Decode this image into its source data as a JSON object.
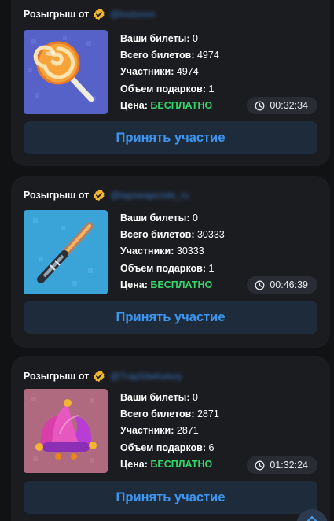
{
  "giveaways": [
    {
      "header_label": "Розыгрыш от",
      "handle": "@lootsmm",
      "prize": "lollipop",
      "labels": {
        "your_tickets": "Ваши билеты:",
        "total_tickets": "Всего билетов:",
        "participants": "Участники:",
        "gifts_count": "Объем подарков:",
        "price": "Цена:"
      },
      "your_tickets": "0",
      "total_tickets": "4974",
      "participants": "4974",
      "gifts_count": "1",
      "price": "БЕСПЛАТНО",
      "timer": "00:32:34",
      "join_label": "Принять участие"
    },
    {
      "header_label": "Розыгрыш от",
      "handle": "@tapswapcode_ru",
      "prize": "lightsaber",
      "labels": {
        "your_tickets": "Ваши билеты:",
        "total_tickets": "Всего билетов:",
        "participants": "Участники:",
        "gifts_count": "Объем подарков:",
        "price": "Цена:"
      },
      "your_tickets": "0",
      "total_tickets": "30333",
      "participants": "30333",
      "gifts_count": "1",
      "price": "БЕСПЛАТНО",
      "timer": "00:46:39",
      "join_label": "Принять участие"
    },
    {
      "header_label": "Розыгрыш от",
      "handle": "@TrapSiteKelory",
      "prize": "jester-hat",
      "labels": {
        "your_tickets": "Ваши билеты:",
        "total_tickets": "Всего билетов:",
        "participants": "Участники:",
        "gifts_count": "Объем подарков:",
        "price": "Цена:"
      },
      "your_tickets": "0",
      "total_tickets": "2871",
      "participants": "2871",
      "gifts_count": "6",
      "price": "БЕСПЛАТНО",
      "timer": "01:32:24",
      "join_label": "Принять участие"
    }
  ],
  "colors": {
    "accent": "#3b97f3",
    "free": "#35d46c",
    "verified": "#f2b632",
    "card_bg": "#1b1c1f",
    "button_bg": "#1e2b3b"
  },
  "icons": {
    "verified": "verified-badge-icon",
    "clock": "clock-icon",
    "scroll_up": "arrow-up-icon"
  }
}
